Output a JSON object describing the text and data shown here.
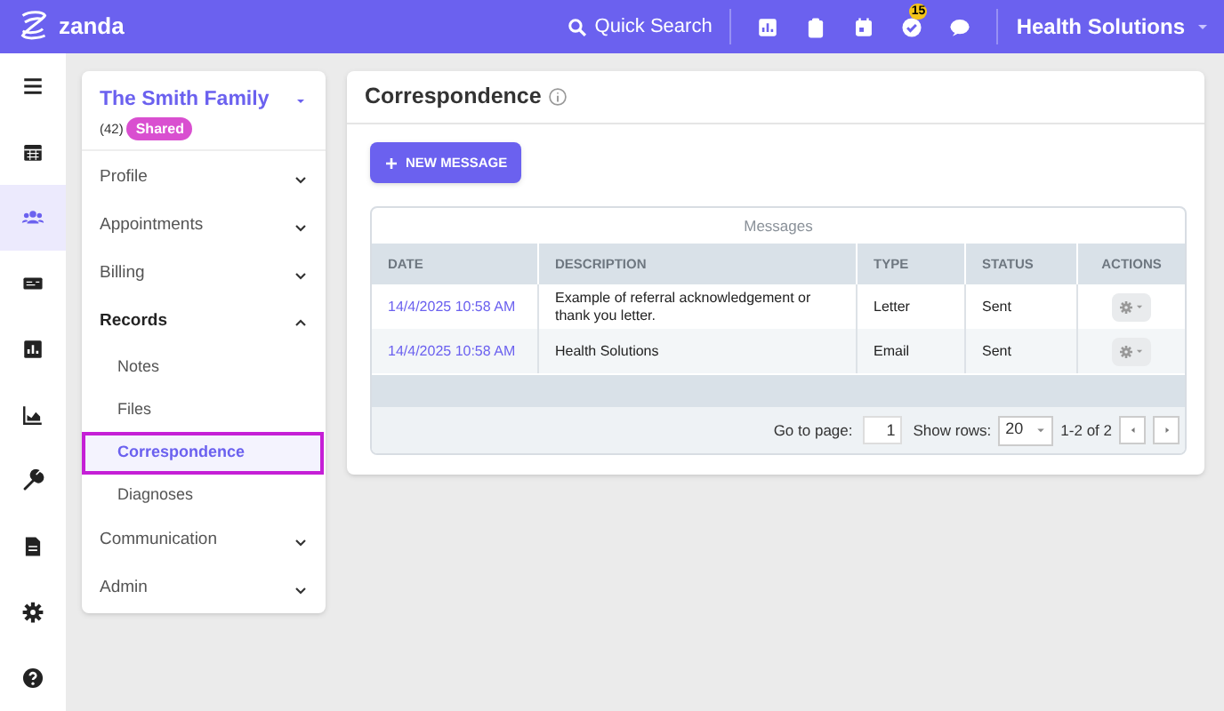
{
  "top_bar": {
    "brand": "zanda",
    "search_label": "Quick Search",
    "task_badge": "15",
    "account": "Health Solutions"
  },
  "rail": [
    {
      "selected": false
    },
    {
      "selected": false
    },
    {
      "selected": true
    },
    {
      "selected": false
    },
    {
      "selected": false
    },
    {
      "selected": false
    },
    {
      "selected": false
    },
    {
      "selected": false
    },
    {
      "selected": false
    },
    {
      "selected": false
    }
  ],
  "client": {
    "name": "The Smith Family",
    "count": "(42)",
    "tag": "Shared"
  },
  "sidebar": {
    "items": [
      {
        "label": "Profile",
        "expanded": false
      },
      {
        "label": "Appointments",
        "expanded": false
      },
      {
        "label": "Billing",
        "expanded": false
      },
      {
        "label": "Records",
        "expanded": true,
        "children": [
          {
            "label": "Notes",
            "selected": false
          },
          {
            "label": "Files",
            "selected": false
          },
          {
            "label": "Correspondence",
            "selected": true
          },
          {
            "label": "Diagnoses",
            "selected": false
          }
        ]
      },
      {
        "label": "Communication",
        "expanded": false
      },
      {
        "label": "Admin",
        "expanded": false
      }
    ]
  },
  "page": {
    "title": "Correspondence",
    "new_button": "NEW MESSAGE"
  },
  "table": {
    "caption": "Messages",
    "columns": [
      "DATE",
      "DESCRIPTION",
      "TYPE",
      "STATUS",
      "ACTIONS"
    ],
    "rows": [
      {
        "date": "14/4/2025 10:58 AM",
        "description": "Example of referral acknowledgement or thank you letter.",
        "type": "Letter",
        "status": "Sent"
      },
      {
        "date": "14/4/2025 10:58 AM",
        "description": "Health Solutions",
        "type": "Email",
        "status": "Sent"
      }
    ]
  },
  "pager": {
    "goto_label": "Go to page:",
    "page": "1",
    "rows_label": "Show rows:",
    "rows": "20",
    "range": "1-2 of 2"
  }
}
